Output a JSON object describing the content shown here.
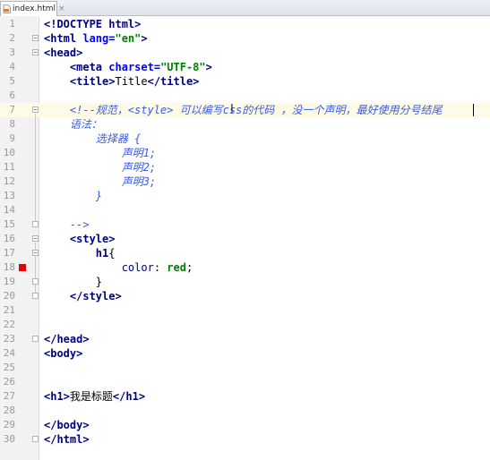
{
  "tab": {
    "filename": "index.html",
    "close_glyph": "×",
    "icon": "html-file-icon"
  },
  "editor": {
    "current_line": 7,
    "breakpoint_line": 18,
    "lines": [
      {
        "n": "1",
        "tokens": [
          [
            "tag",
            "<!DOCTYPE "
          ],
          [
            "tag",
            "html"
          ],
          [
            "tag",
            ">"
          ]
        ]
      },
      {
        "n": "2",
        "tokens": [
          [
            "tag",
            "<html "
          ],
          [
            "attr",
            "lang="
          ],
          [
            "str",
            "\"en\""
          ],
          [
            "tag",
            ">"
          ]
        ]
      },
      {
        "n": "3",
        "tokens": [
          [
            "tag",
            "<head>"
          ]
        ]
      },
      {
        "n": "4",
        "tokens": [
          [
            "plain",
            "    "
          ],
          [
            "tag",
            "<meta "
          ],
          [
            "attr",
            "charset="
          ],
          [
            "str",
            "\"UTF-8\""
          ],
          [
            "tag",
            ">"
          ]
        ]
      },
      {
        "n": "5",
        "tokens": [
          [
            "plain",
            "    "
          ],
          [
            "tag",
            "<title>"
          ],
          [
            "plain",
            "Title"
          ],
          [
            "tag",
            "</title>"
          ]
        ]
      },
      {
        "n": "6",
        "tokens": []
      },
      {
        "n": "7",
        "tokens": [
          [
            "plain",
            "    "
          ],
          [
            "cmt",
            "<!--规范，<style> 可以编写css的代码 ，没一个声明，最好使用分号结尾"
          ]
        ]
      },
      {
        "n": "8",
        "tokens": [
          [
            "plain",
            "    "
          ],
          [
            "cmt",
            "语法："
          ]
        ]
      },
      {
        "n": "9",
        "tokens": [
          [
            "plain",
            "        "
          ],
          [
            "cmt",
            "选择器 {"
          ]
        ]
      },
      {
        "n": "10",
        "tokens": [
          [
            "plain",
            "            "
          ],
          [
            "cmt",
            "声明1;"
          ]
        ]
      },
      {
        "n": "11",
        "tokens": [
          [
            "plain",
            "            "
          ],
          [
            "cmt",
            "声明2;"
          ]
        ]
      },
      {
        "n": "12",
        "tokens": [
          [
            "plain",
            "            "
          ],
          [
            "cmt",
            "声明3;"
          ]
        ]
      },
      {
        "n": "13",
        "tokens": [
          [
            "plain",
            "        "
          ],
          [
            "cmt",
            "}"
          ]
        ]
      },
      {
        "n": "14",
        "tokens": []
      },
      {
        "n": "15",
        "tokens": [
          [
            "plain",
            "    "
          ],
          [
            "cmt",
            "-->"
          ]
        ]
      },
      {
        "n": "16",
        "tokens": [
          [
            "plain",
            "    "
          ],
          [
            "tag",
            "<style>"
          ]
        ]
      },
      {
        "n": "17",
        "tokens": [
          [
            "plain",
            "        "
          ],
          [
            "tag",
            "h1"
          ],
          [
            "plain",
            "{"
          ]
        ]
      },
      {
        "n": "18",
        "tokens": [
          [
            "plain",
            "            "
          ],
          [
            "prop",
            "color"
          ],
          [
            "plain",
            ": "
          ],
          [
            "val",
            "red"
          ],
          [
            "plain",
            ";"
          ]
        ]
      },
      {
        "n": "19",
        "tokens": [
          [
            "plain",
            "        "
          ],
          [
            "plain",
            "}"
          ]
        ]
      },
      {
        "n": "20",
        "tokens": [
          [
            "plain",
            "    "
          ],
          [
            "tag",
            "</style>"
          ]
        ]
      },
      {
        "n": "21",
        "tokens": []
      },
      {
        "n": "22",
        "tokens": []
      },
      {
        "n": "23",
        "tokens": [
          [
            "tag",
            "</head>"
          ]
        ]
      },
      {
        "n": "24",
        "tokens": [
          [
            "tag",
            "<body>"
          ]
        ]
      },
      {
        "n": "25",
        "tokens": []
      },
      {
        "n": "26",
        "tokens": []
      },
      {
        "n": "27",
        "tokens": [
          [
            "tag",
            "<h1>"
          ],
          [
            "plain",
            "我是标题"
          ],
          [
            "tag",
            "</h1>"
          ]
        ]
      },
      {
        "n": "28",
        "tokens": []
      },
      {
        "n": "29",
        "tokens": [
          [
            "tag",
            "</body>"
          ]
        ]
      },
      {
        "n": "30",
        "tokens": [
          [
            "tag",
            "</html>"
          ]
        ]
      }
    ]
  },
  "colors": {
    "tag": "#000080",
    "attr": "#0000ff",
    "string": "#008000",
    "comment": "#3b5bdb",
    "breakpoint": "#e00000",
    "current_line_bg": "#fdfbe6"
  }
}
